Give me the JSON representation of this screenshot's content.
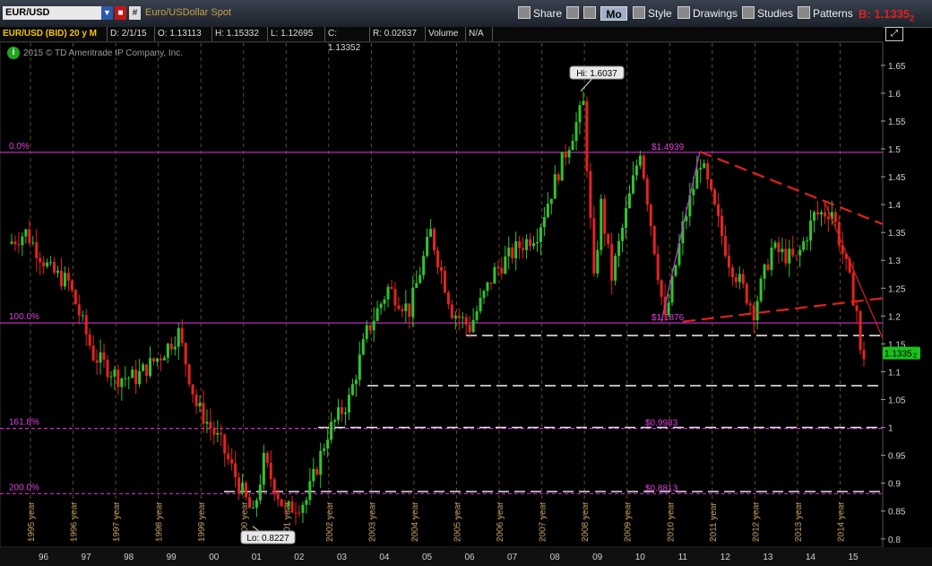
{
  "toolbar": {
    "symbol": "EUR/USD",
    "description": "Euro/USDollar Spot",
    "share_label": "Share",
    "period_label": "Mo",
    "style_label": "Style",
    "drawings_label": "Drawings",
    "studies_label": "Studies",
    "patterns_label": "Patterns",
    "bid_label": "B: 1.1335",
    "bid_subscript": "2"
  },
  "infobar": {
    "title": "EUR/USD (BID) 20 y M",
    "date": "D: 2/1/15",
    "open": "O: 1.13113",
    "high": "H: 1.15332",
    "low": "L: 1.12695",
    "close": "C: 1.13352",
    "range": "R: 0.02637",
    "volume_label": "Volume",
    "volume_value": "N/A"
  },
  "copyright": "2015 © TD Ameritrade IP Company, Inc.",
  "colors": {
    "up": "#2fc42f",
    "down": "#e52222",
    "fib": "#d12bd1",
    "trend": "#e02020",
    "accent": "#f2c300"
  },
  "chart_data": {
    "type": "candlestick",
    "y_ticks": [
      0.8,
      0.85,
      0.9,
      0.95,
      1,
      1.05,
      1.1,
      1.15,
      1.2,
      1.25,
      1.3,
      1.35,
      1.4,
      1.45,
      1.5,
      1.55,
      1.6,
      1.65
    ],
    "ylim": [
      0.79,
      1.69
    ],
    "x_year_labels": [
      "1995 year",
      "1996 year",
      "1997 year",
      "1998 year",
      "1999 year",
      "2000 year",
      "2001 year",
      "2002 year",
      "2003 year",
      "2004 year",
      "2005 year",
      "2006 year",
      "2007 year",
      "2008 year",
      "2009 year",
      "2010 year",
      "2011 year",
      "2012 year",
      "2013 year",
      "2014 year"
    ],
    "x_short_labels": [
      "96",
      "97",
      "98",
      "99",
      "00",
      "01",
      "02",
      "03",
      "04",
      "05",
      "06",
      "07",
      "08",
      "09",
      "10",
      "11",
      "12",
      "13",
      "14",
      "15"
    ],
    "yearly_path": [
      [
        "1995-01",
        1.33
      ],
      [
        "1995-06",
        1.35
      ],
      [
        "1996-01",
        1.28
      ],
      [
        "1996-06",
        1.26
      ],
      [
        "1997-01",
        1.13
      ],
      [
        "1997-08",
        1.09
      ],
      [
        "1998-01",
        1.09
      ],
      [
        "1998-08",
        1.13
      ],
      [
        "1999-01",
        1.17
      ],
      [
        "1999-06",
        1.04
      ],
      [
        "2000-01",
        0.97
      ],
      [
        "2000-10",
        0.84
      ],
      [
        "2001-01",
        0.94
      ],
      [
        "2001-07",
        0.85
      ],
      [
        "2002-01",
        0.87
      ],
      [
        "2002-07",
        0.99
      ],
      [
        "2003-01",
        1.05
      ],
      [
        "2003-06",
        1.17
      ],
      [
        "2003-12",
        1.25
      ],
      [
        "2004-06",
        1.21
      ],
      [
        "2004-12",
        1.35
      ],
      [
        "2005-06",
        1.21
      ],
      [
        "2005-11",
        1.18
      ],
      [
        "2006-06",
        1.28
      ],
      [
        "2006-12",
        1.32
      ],
      [
        "2007-06",
        1.35
      ],
      [
        "2007-12",
        1.46
      ],
      [
        "2008-07",
        1.58
      ],
      [
        "2008-10",
        1.26
      ],
      [
        "2008-12",
        1.4
      ],
      [
        "2009-03",
        1.27
      ],
      [
        "2009-11",
        1.5
      ],
      [
        "2010-06",
        1.19
      ],
      [
        "2010-11",
        1.36
      ],
      [
        "2011-04",
        1.48
      ],
      [
        "2011-12",
        1.3
      ],
      [
        "2012-07",
        1.21
      ],
      [
        "2012-12",
        1.32
      ],
      [
        "2013-07",
        1.3
      ],
      [
        "2013-12",
        1.38
      ],
      [
        "2014-05",
        1.39
      ],
      [
        "2014-12",
        1.21
      ],
      [
        "2015-01",
        1.13
      ]
    ],
    "high_marker": "Hi: 1.6037",
    "low_marker": "Lo: 0.8227",
    "fib_levels": [
      {
        "pct": "0.0%",
        "value": 1.4939,
        "label": "$1.4939"
      },
      {
        "pct": "100.0%",
        "value": 1.1876,
        "label": "$1.1876"
      },
      {
        "pct": "161.8%",
        "value": 0.9983,
        "label": "$0.9983"
      },
      {
        "pct": "200.0%",
        "value": 0.8813,
        "label": "$0.8813"
      }
    ],
    "support_lines": [
      1.165,
      1.075,
      1.0,
      0.885
    ],
    "last_price_label": "1.1335",
    "last_price_sub": "2",
    "last_price": 1.1335
  }
}
